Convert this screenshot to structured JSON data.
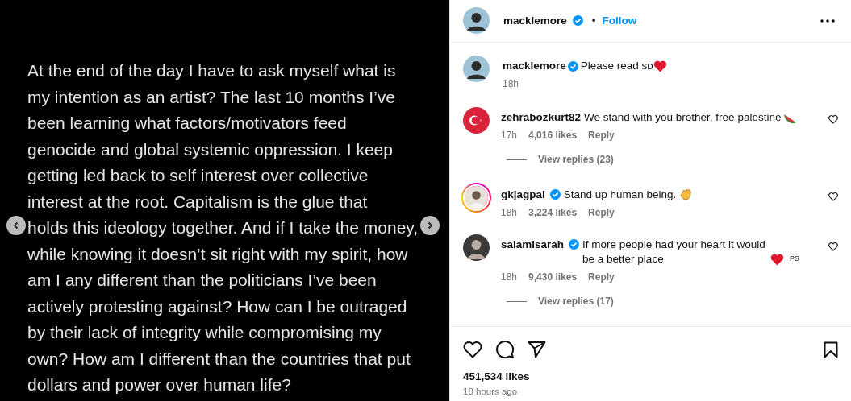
{
  "post_image": {
    "lines": [
      "At the end of the day I have to ask myself what is",
      "my intention as an artist? The last 10 months I’ve",
      "been learning what factors/motivators feed",
      "genocide and global systemic oppression. I keep",
      "getting led back to self interest over collective",
      "interest at the root.  Capitalism is the glue that",
      "holds this ideology together. And if I take the money,",
      "while knowing it doesn’t sit right with my spirit, how",
      "am I any different than the politicians I’ve been",
      "actively protesting against? How can I be outraged",
      "by their lack of integrity while compromising my",
      "own? How am I different than the countries that put",
      "dollars and power over human life?"
    ]
  },
  "header": {
    "username": "macklemore",
    "verified": true,
    "separator": "•",
    "follow": "Follow"
  },
  "caption": {
    "username": "macklemore",
    "verified": true,
    "text": "Please read sᴅ",
    "emoji": {
      "kind": "heart"
    },
    "time": "18h"
  },
  "comments": [
    {
      "username": "zehrabozkurt82",
      "verified": false,
      "story_ring": false,
      "avatar": {
        "kind": "flag"
      },
      "text": "We stand with you brother, free palestine",
      "emoji": {
        "kind": "watermelon"
      },
      "time": "17h",
      "likes": "4,016 likes",
      "reply": "Reply",
      "view_replies": "View replies (23)"
    },
    {
      "username": "gkjagpal",
      "verified": true,
      "story_ring": true,
      "avatar": {
        "kind": "light"
      },
      "text": "Stand up human being.",
      "emoji": {
        "kind": "clap"
      },
      "time": "18h",
      "likes": "3,224 likes",
      "reply": "Reply"
    },
    {
      "username": "salamisarah",
      "verified": true,
      "story_ring": false,
      "avatar": {
        "kind": "dark"
      },
      "text": "If more people had your heart it would be a better place",
      "emoji": {
        "kind": "heart"
      },
      "suffix": "PS",
      "time": "18h",
      "likes": "9,430 likes",
      "reply": "Reply",
      "view_replies": "View replies (17)"
    }
  ],
  "likes": "451,534 likes",
  "time_ago": "18 hours ago"
}
